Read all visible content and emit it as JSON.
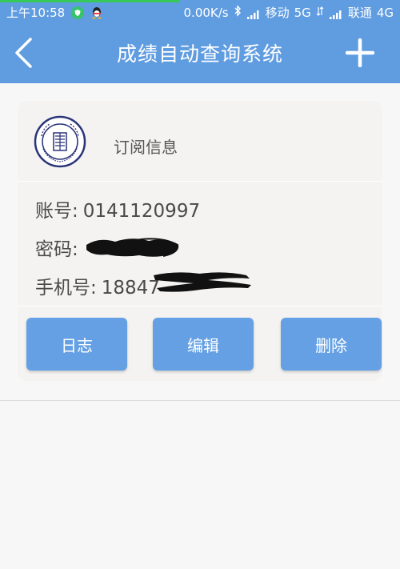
{
  "status_bar": {
    "time": "上午10:58",
    "speed": "0.00K/s",
    "carrier1": "移动",
    "network1": "5G",
    "carrier2": "联通",
    "network2": "4G",
    "icons": [
      "shield-icon",
      "qq-icon",
      "bluetooth-icon",
      "signal-icon",
      "wifi-icon"
    ]
  },
  "header": {
    "title": "成绩自动查询系统",
    "back_icon": "chevron-left-icon",
    "add_icon": "plus-icon",
    "background_color": "#5f9ce0"
  },
  "card": {
    "logo_icon": "university-seal-icon",
    "subscription_label": "订阅信息",
    "account_label": "账号:",
    "account_value": "0141120997",
    "password_label": "密码:",
    "phone_label": "手机号:",
    "phone_value_visible": "18847",
    "buttons": {
      "log": "日志",
      "edit": "编辑",
      "delete": "删除"
    },
    "button_color": "#64a0e3"
  }
}
